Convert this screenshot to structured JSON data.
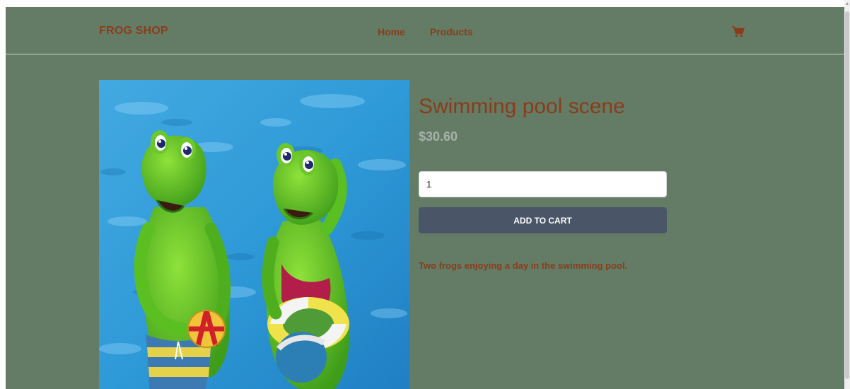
{
  "brand": {
    "name": "FROG SHOP"
  },
  "nav": {
    "links": [
      {
        "label": "Home"
      },
      {
        "label": "Products"
      }
    ],
    "cart_icon": "shopping-cart-icon"
  },
  "product": {
    "title": "Swimming pool scene",
    "price": "$30.60",
    "quantity": "1",
    "add_to_cart_label": "ADD TO CART",
    "description": "Two frogs enjoying a day in the swimming pool.",
    "image_alt": "Two frog figurines by a swimming pool"
  },
  "colors": {
    "background": "#647c66",
    "accent_text": "#8a3c1a",
    "price_text": "#a8b2ab",
    "button": "#4a5668",
    "button_text": "#ffffff"
  }
}
